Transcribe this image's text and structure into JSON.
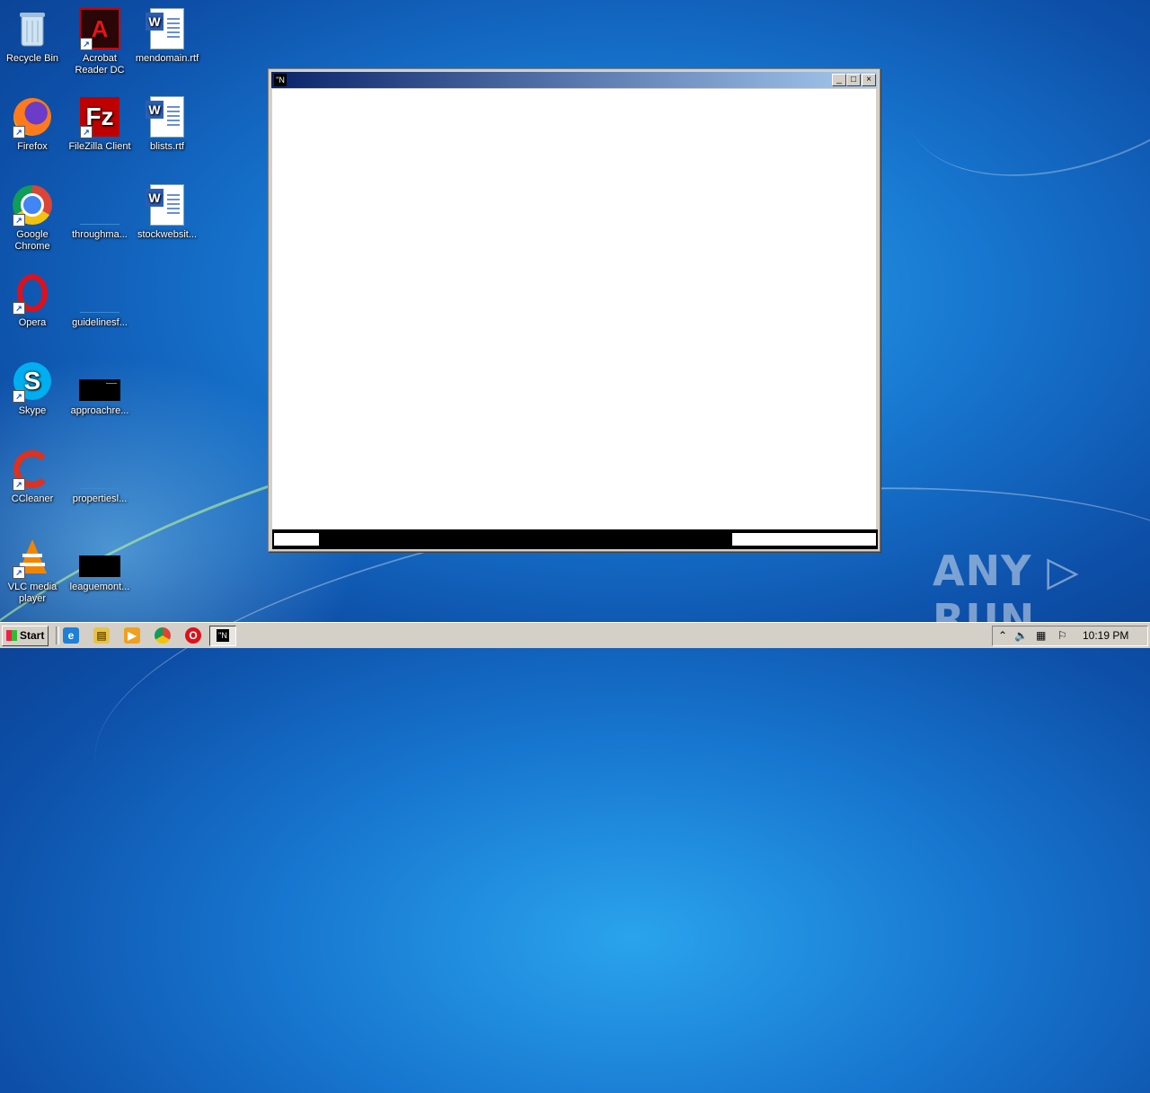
{
  "desktop": {
    "icons": [
      {
        "label": "Recycle Bin",
        "icon": "recycle-bin-icon"
      },
      {
        "label": "Acrobat Reader DC",
        "icon": "acrobat-icon"
      },
      {
        "label": "mendomain.rtf",
        "icon": "word-document-icon"
      },
      {
        "label": "Firefox",
        "icon": "firefox-icon"
      },
      {
        "label": "FileZilla Client",
        "icon": "filezilla-icon"
      },
      {
        "label": "blists.rtf",
        "icon": "word-document-icon"
      },
      {
        "label": "Google Chrome",
        "icon": "chrome-icon"
      },
      {
        "label": "throughma...",
        "icon": "blank-file-icon"
      },
      {
        "label": "stockwebsit...",
        "icon": "word-document-icon"
      },
      {
        "label": "Opera",
        "icon": "opera-icon"
      },
      {
        "label": "guidelinesf...",
        "icon": "blank-file-icon"
      },
      {
        "label": "Skype",
        "icon": "skype-icon"
      },
      {
        "label": "approachre...",
        "icon": "black-file-icon"
      },
      {
        "label": "CCleaner",
        "icon": "ccleaner-icon"
      },
      {
        "label": "propertiesl...",
        "icon": "blank-file-icon"
      },
      {
        "label": "VLC media player",
        "icon": "vlc-icon"
      },
      {
        "label": "leaguemont...",
        "icon": "black-file-icon"
      }
    ]
  },
  "window": {
    "title": "",
    "icon_glyph": "\"N",
    "minimize": "_",
    "maximize": "□",
    "close": "×"
  },
  "watermark": "ANY ▷ RUN",
  "taskbar": {
    "start_label": "Start",
    "clock": "10:19 PM",
    "tray_arrow": "⌃",
    "task_glyph": "\"N"
  },
  "colors": {
    "titlebar_start": "#0a246a",
    "titlebar_end": "#a6caf0",
    "desktop_blue": "#1776cf"
  }
}
